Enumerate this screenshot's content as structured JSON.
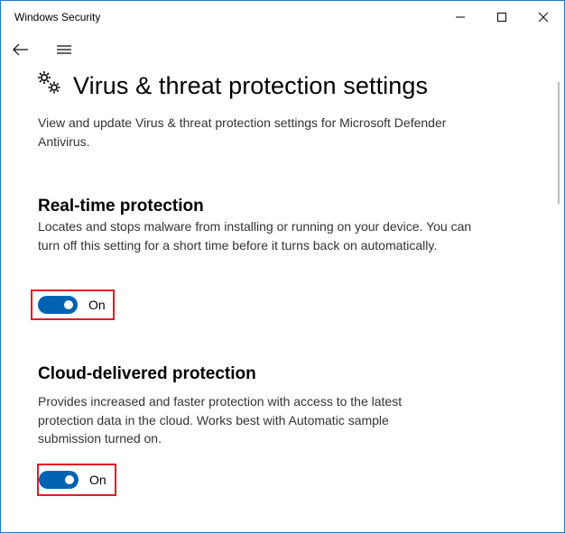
{
  "window": {
    "title": "Windows Security",
    "controls": [
      "minimize-icon",
      "maximize-icon",
      "close-icon"
    ]
  },
  "nav": {
    "back_icon": "arrow-left-icon",
    "menu_icon": "hamburger-menu-icon"
  },
  "page": {
    "icon": "gears-icon",
    "title": "Virus & threat protection settings",
    "description": "View and update Virus & threat protection settings for Microsoft Defender Antivirus."
  },
  "sections": {
    "realtime": {
      "title": "Real-time protection",
      "description": "Locates and stops malware from installing or running on your device. You can turn off this setting for a short time before it turns back on automatically.",
      "toggle_state": "On"
    },
    "cloud": {
      "title": "Cloud-delivered protection",
      "description": "Provides increased and faster protection with access to the latest protection data in the cloud. Works best with Automatic sample submission turned on.",
      "toggle_state": "On"
    }
  },
  "colors": {
    "accent": "#0063b1",
    "highlight_border": "#e41b23",
    "window_border": "#1979ca"
  }
}
